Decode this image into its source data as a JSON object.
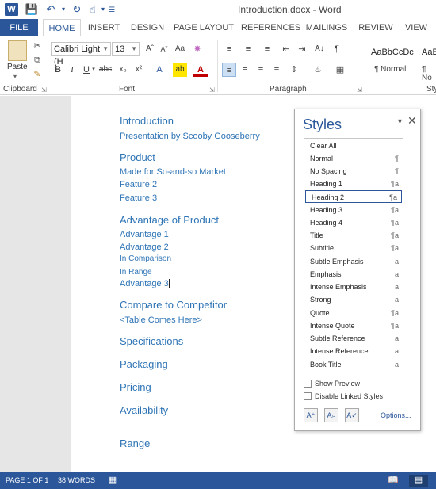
{
  "titlebar": {
    "app_icon": "W",
    "document_title": "Introduction.docx - Word",
    "icons": [
      "word-app-icon",
      "save-icon",
      "undo-icon",
      "redo-icon",
      "touch-mode-icon",
      "customize-qat-icon"
    ]
  },
  "tabs": [
    "FILE",
    "HOME",
    "INSERT",
    "DESIGN",
    "PAGE LAYOUT",
    "REFERENCES",
    "MAILINGS",
    "REVIEW",
    "VIEW"
  ],
  "ribbon": {
    "paste_label": "Paste",
    "clipboard_label": "Clipboard",
    "font_label": "Font",
    "paragraph_label": "Paragraph",
    "styles_label": "Sty",
    "font_name": "Calibri Light (H",
    "font_size": "13",
    "style_gallery": [
      {
        "preview": "AaBbCcDc",
        "name": "¶ Normal"
      },
      {
        "preview": "AaBb",
        "name": "¶ No"
      }
    ]
  },
  "document": {
    "lines": [
      {
        "text": "Introduction",
        "style": "h1"
      },
      {
        "text": "Presentation by Scooby Gooseberry",
        "style": "h2"
      },
      {
        "text": "Product",
        "style": "h1"
      },
      {
        "text": "Made for So-and-so Market",
        "style": "h2"
      },
      {
        "text": "Feature 2",
        "style": "h2"
      },
      {
        "text": "Feature 3",
        "style": "h2"
      },
      {
        "text": "Advantage of Product",
        "style": "h1"
      },
      {
        "text": "Advantage 1",
        "style": "h2"
      },
      {
        "text": "Advantage 2",
        "style": "h2"
      },
      {
        "text": "In Comparison",
        "style": "nrm"
      },
      {
        "text": "In Range",
        "style": "nrm"
      },
      {
        "text": "Advantage 3",
        "style": "h2"
      },
      {
        "text": "Compare to Competitor",
        "style": "h1"
      },
      {
        "text": "<Table Comes Here>",
        "style": "h2"
      },
      {
        "text": "Specifications",
        "style": "h1"
      },
      {
        "text": "Packaging",
        "style": "h1"
      },
      {
        "text": "Pricing",
        "style": "h1"
      },
      {
        "text": "Availability",
        "style": "h1"
      },
      {
        "text": "Range",
        "style": "h1"
      }
    ]
  },
  "styles_pane": {
    "title": "Styles",
    "menu_glyph": "▼",
    "close_glyph": "✕",
    "items": [
      {
        "name": "Clear All",
        "mark": ""
      },
      {
        "name": "Normal",
        "mark": "¶"
      },
      {
        "name": "No Spacing",
        "mark": "¶"
      },
      {
        "name": "Heading 1",
        "mark": "¶a"
      },
      {
        "name": "Heading 2",
        "mark": "¶a",
        "selected": true
      },
      {
        "name": "Heading 3",
        "mark": "¶a"
      },
      {
        "name": "Heading 4",
        "mark": "¶a"
      },
      {
        "name": "Title",
        "mark": "¶a"
      },
      {
        "name": "Subtitle",
        "mark": "¶a"
      },
      {
        "name": "Subtle Emphasis",
        "mark": "a"
      },
      {
        "name": "Emphasis",
        "mark": "a"
      },
      {
        "name": "Intense Emphasis",
        "mark": "a"
      },
      {
        "name": "Strong",
        "mark": "a"
      },
      {
        "name": "Quote",
        "mark": "¶a"
      },
      {
        "name": "Intense Quote",
        "mark": "¶a"
      },
      {
        "name": "Subtle Reference",
        "mark": "a"
      },
      {
        "name": "Intense Reference",
        "mark": "a"
      },
      {
        "name": "Book Title",
        "mark": "a"
      }
    ],
    "show_preview_label": "Show Preview",
    "disable_linked_label": "Disable Linked Styles",
    "options_label": "Options..."
  },
  "statusbar": {
    "page": "PAGE 1 OF 1",
    "words": "38 WORDS"
  },
  "colors": {
    "accent": "#2b579a",
    "heading": "#2e74b5"
  }
}
